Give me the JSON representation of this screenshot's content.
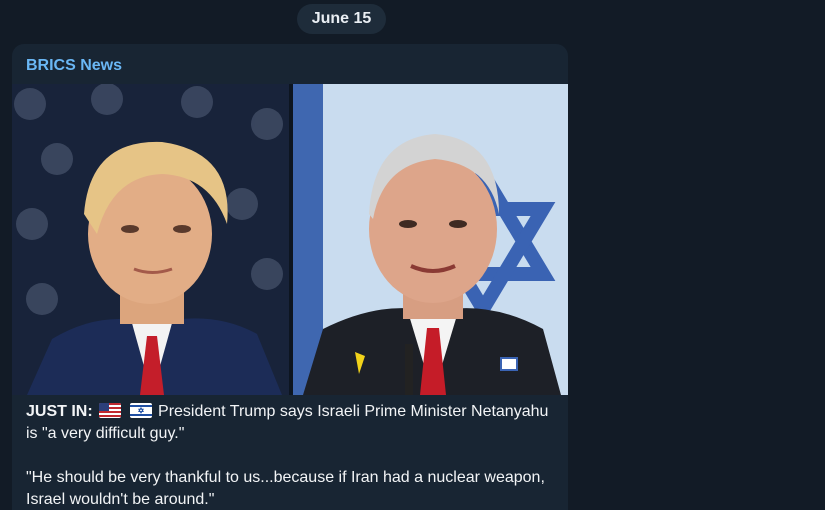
{
  "date_separator": "June 15",
  "post": {
    "channel": "BRICS News",
    "photos": [
      {
        "icon": "portrait-photo-left"
      },
      {
        "icon": "portrait-photo-right"
      }
    ],
    "lead": "JUST IN:",
    "flags": [
      "us-flag-icon",
      "israel-flag-icon"
    ],
    "line1": "President Trump says Israeli Prime Minister Netanyahu is \"a very difficult guy.\"",
    "line2": "\"He should be very thankful to us...because if Iran had a nuclear weapon, Israel wouldn't be around.\""
  },
  "colors": {
    "background": "#121b26",
    "bubble": "#182533",
    "channel_name": "#6ab7f5",
    "date_pill": "#1e2c3a"
  }
}
